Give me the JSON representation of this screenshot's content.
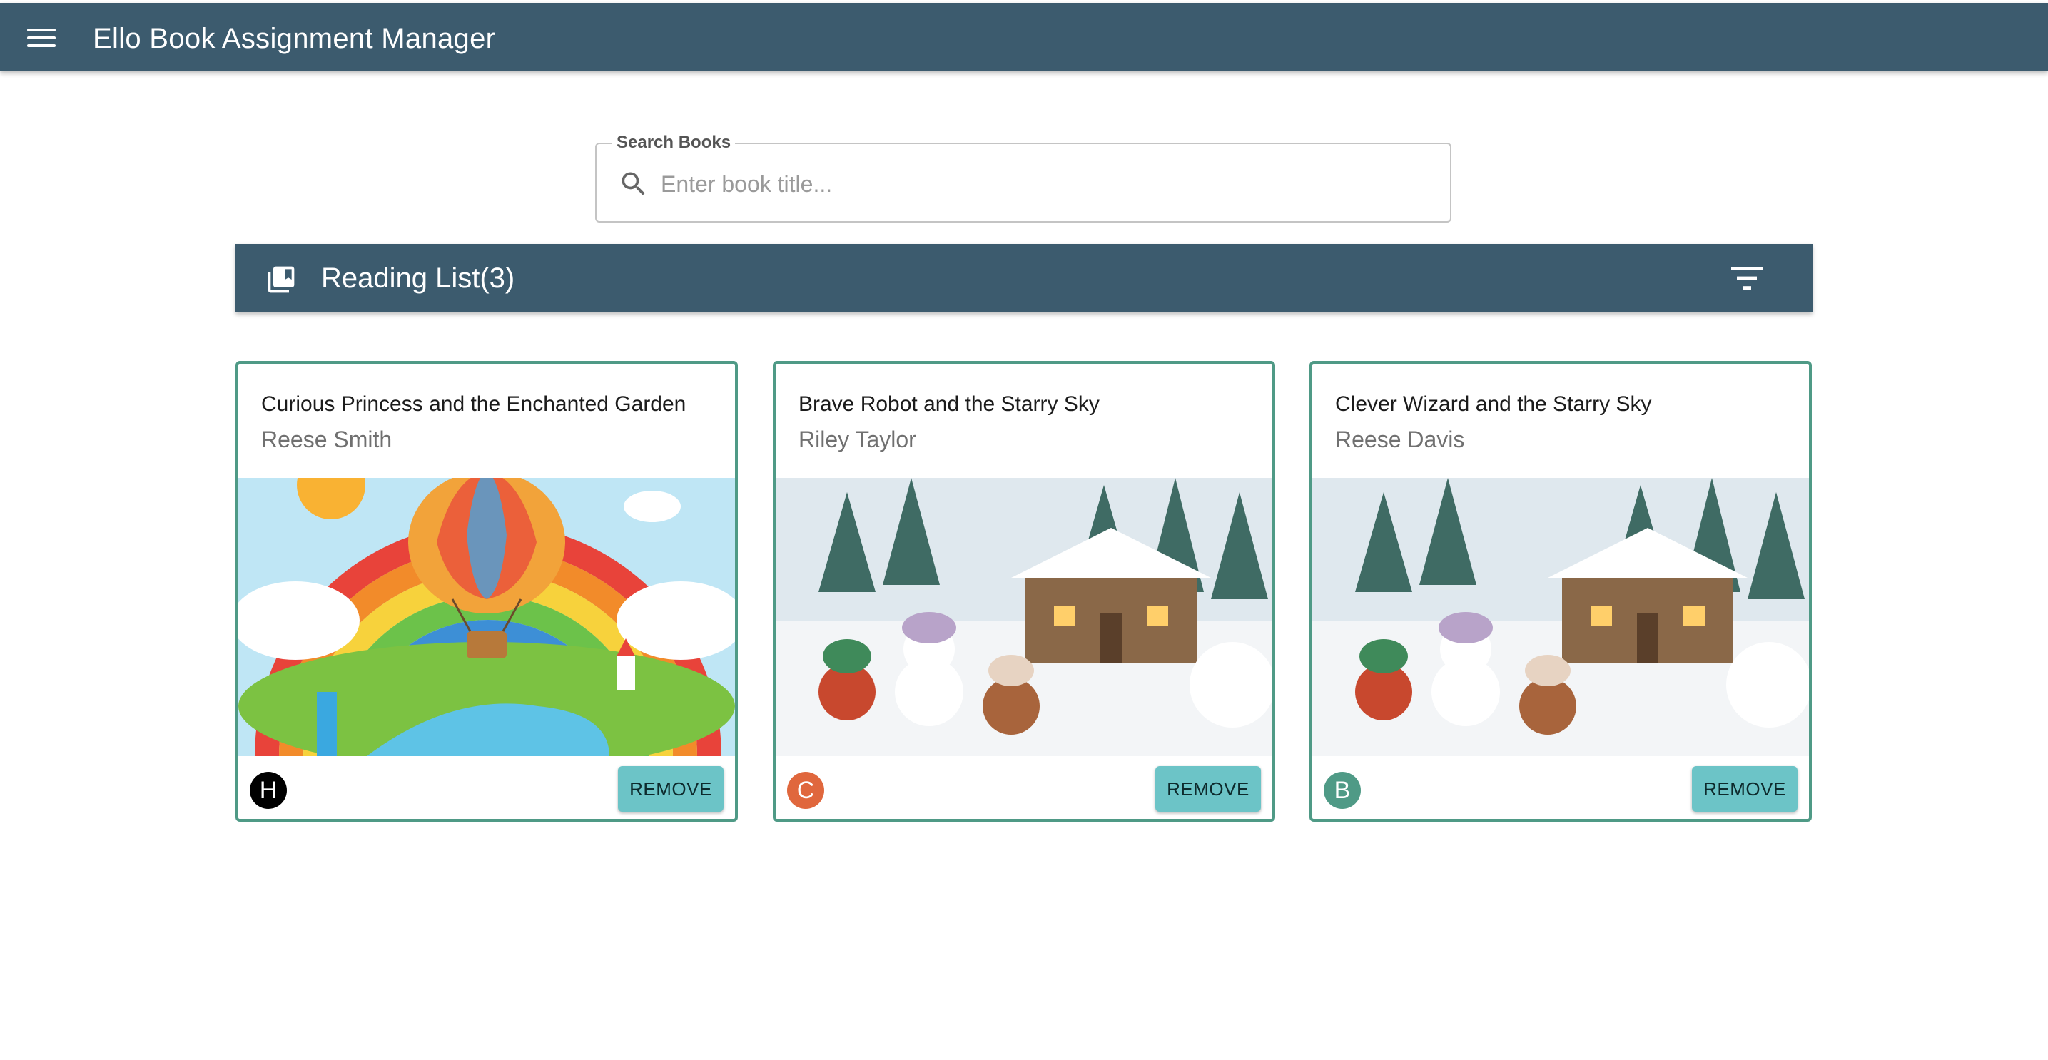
{
  "appbar": {
    "title": "Ello Book Assignment Manager"
  },
  "search": {
    "legend": "Search Books",
    "placeholder": "Enter book title...",
    "value": ""
  },
  "reading_list": {
    "title": "Reading List(3)",
    "books": [
      {
        "title": "Curious Princess and the Enchanted Garden",
        "author": "Reese Smith",
        "avatar_letter": "H",
        "avatar_color": "#000000",
        "remove_label": "REMOVE",
        "illustration": "rainbow-hot-air-balloon"
      },
      {
        "title": "Brave Robot and the Starry Sky",
        "author": "Riley Taylor",
        "avatar_letter": "C",
        "avatar_color": "#e0673d",
        "remove_label": "REMOVE",
        "illustration": "snowy-village-snowman"
      },
      {
        "title": "Clever Wizard and the Starry Sky",
        "author": "Reese Davis",
        "avatar_letter": "B",
        "avatar_color": "#4f9a86",
        "remove_label": "REMOVE",
        "illustration": "snowy-village-snowman"
      }
    ]
  },
  "colors": {
    "primary": "#3c5b6e",
    "accent": "#6cc4c7",
    "card_border": "#4f9a86"
  },
  "icons": {
    "menu": "menu-icon",
    "search": "search-icon",
    "books": "library-books-icon",
    "filter": "filter-list-icon"
  }
}
